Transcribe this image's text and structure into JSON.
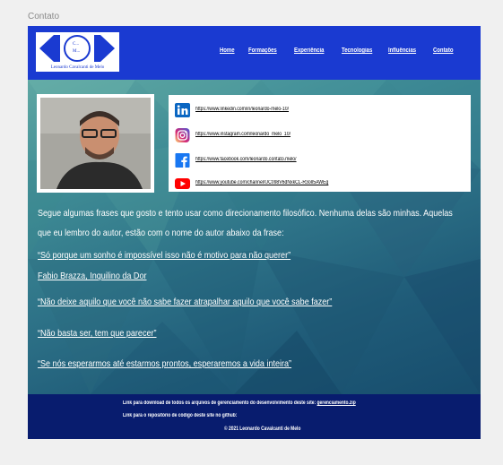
{
  "frame_label": "Contato",
  "logo": {
    "initials": "C... M...",
    "caption": "Leonardo Cavalcanti de Melo"
  },
  "nav": [
    {
      "label": "Home"
    },
    {
      "label": "Formações"
    },
    {
      "label": "Experiência"
    },
    {
      "label": "Tecnologias"
    },
    {
      "label": "Influências"
    },
    {
      "label": "Contato"
    }
  ],
  "social": [
    {
      "icon": "linkedin-icon",
      "url": "https://www.linkedin.com/in/leonardo-melo-10/",
      "color": "#0a66c2"
    },
    {
      "icon": "instagram-icon",
      "url": "https://www.instagram.com/leonardo_melo_10/",
      "color": "#d62976"
    },
    {
      "icon": "facebook-icon",
      "url": "https://www.facebook.com/leonardo.contato.melo/",
      "color": "#1877f2"
    },
    {
      "icon": "youtube-icon",
      "url": "https://www.youtube.com/channel/UC098V6dNxkCL-R3oIl5AWEg",
      "color": "#ff0000"
    }
  ],
  "intro": "Segue algumas frases que gosto e tento usar como direcionamento filosófico. Nenhuma delas são minhas. Aquelas que eu lembro do autor, estão com o nome do autor abaixo da frase:",
  "quotes": [
    {
      "text": "“Só porque um sonho é impossível isso não é motivo para não querer”",
      "author": "Fabio Brazza, Inquilino da Dor"
    },
    {
      "text": "“Não deixe aquilo que você não sabe fazer atrapalhar aquilo que você sabe fazer”",
      "author": ""
    },
    {
      "text": "“Não basta ser, tem que parecer”",
      "author": ""
    },
    {
      "text": "“Se nós esperarmos até estarmos prontos, esperaremos a vida inteira”",
      "author": ""
    }
  ],
  "footer": {
    "download_text": "Link para download de todos os arquivos de gerenciamento do desenvolvimento deste site:",
    "download_link": "gerenciamento.zip",
    "repo_text": "Link para o repositório de código deste site no github:",
    "copyright": "© 2021 Leonardo Cavalcanti de Melo"
  },
  "colors": {
    "header": "#1a3ad1",
    "footer": "#081c6e",
    "background_teal": "#3f8c95"
  }
}
